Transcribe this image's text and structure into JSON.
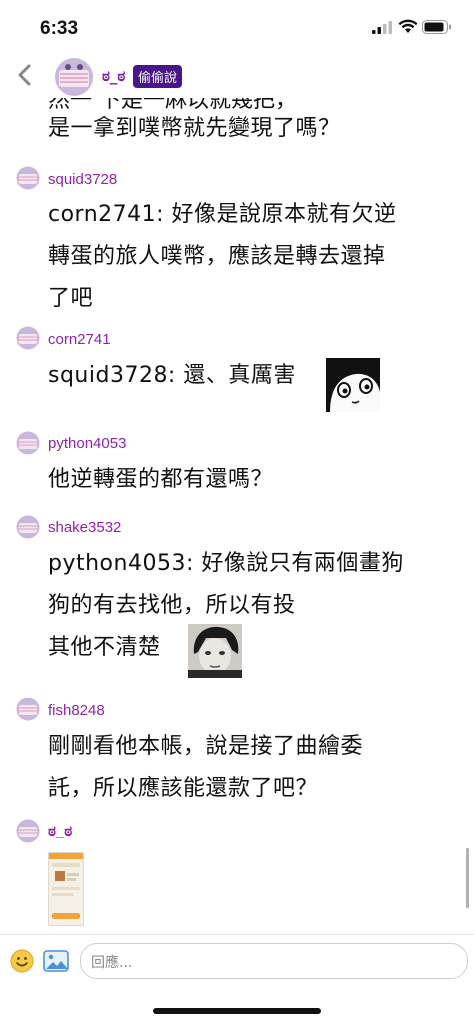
{
  "status": {
    "time": "6:33"
  },
  "header": {
    "name": "ಠ_ಠ",
    "badge": "偷偷說"
  },
  "partial_text": "然一 下是一麻以就幾把，",
  "messages": [
    {
      "user": "",
      "lines": [
        "是一拿到噗幣就先變現了嗎？"
      ]
    },
    {
      "user": "squid3728",
      "lines": [
        "corn2741: 好像是說原本就有欠逆",
        "轉蛋的旅人噗幣，應該是轉去還掉",
        "了吧"
      ]
    },
    {
      "user": "corn2741",
      "lines": [
        "squid3728: 還、真厲害"
      ]
    },
    {
      "user": "python4053",
      "lines": [
        "他逆轉蛋的都有還嗎？"
      ]
    },
    {
      "user": "shake3532",
      "lines": [
        "python4053: 好像說只有兩個畫狗",
        "狗的有去找他，所以有投",
        "其他不清楚"
      ]
    },
    {
      "user": "fish8248",
      "lines": [
        "剛剛看他本帳，說是接了曲繪委",
        "託，所以應該能還款了吧？"
      ]
    },
    {
      "user": "ಠ_ಠ",
      "lines": []
    }
  ],
  "input": {
    "placeholder": "回應..."
  },
  "icons": {
    "back": "chevron-left-icon",
    "emoji": "smiley-icon",
    "image": "image-upload-icon"
  },
  "colors": {
    "username": "#8e24aa",
    "badge_bg": "#4a148c"
  }
}
